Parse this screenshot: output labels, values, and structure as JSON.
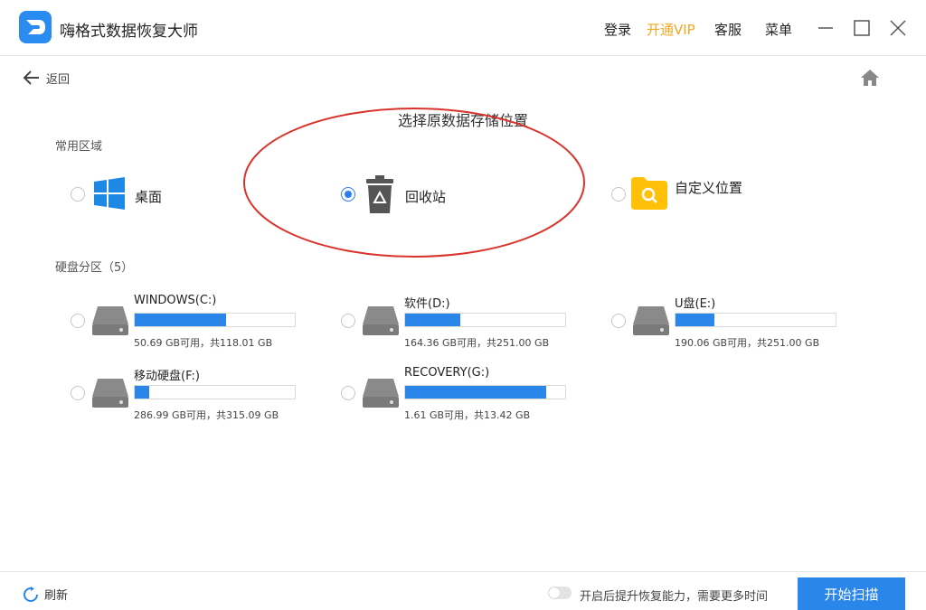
{
  "app": {
    "title": "嗨格式数据恢复大师"
  },
  "topbar": {
    "login": "登录",
    "vip": "开通VIP",
    "service": "客服",
    "menu": "菜单"
  },
  "nav": {
    "back": "返回"
  },
  "main": {
    "title": "选择原数据存储位置"
  },
  "common": {
    "label": "常用区域",
    "items": [
      {
        "label": "桌面",
        "selected": false,
        "icon": "windows-icon"
      },
      {
        "label": "回收站",
        "selected": true,
        "icon": "recycle-bin-icon"
      },
      {
        "label": "自定义位置",
        "selected": false,
        "icon": "folder-search-icon"
      }
    ]
  },
  "partitions": {
    "label": "硬盘分区（5）",
    "drives": [
      {
        "name": "WINDOWS(C:)",
        "info": "50.69 GB可用，共118.01 GB",
        "used_fraction": 0.57
      },
      {
        "name": "软件(D:)",
        "info": "164.36 GB可用，共251.00 GB",
        "used_fraction": 0.345
      },
      {
        "name": "U盘(E:)",
        "info": "190.06 GB可用，共251.00 GB",
        "used_fraction": 0.243
      },
      {
        "name": "移动硬盘(F:)",
        "info": "286.99 GB可用，共315.09 GB",
        "used_fraction": 0.089
      },
      {
        "name": "RECOVERY(G:)",
        "info": "1.61 GB可用，共13.42 GB",
        "used_fraction": 0.88
      }
    ]
  },
  "footer": {
    "refresh": "刷新",
    "toggle_text": "开启后提升恢复能力，需要更多时间",
    "toggle_on": false,
    "start": "开始扫描"
  },
  "colors": {
    "accent": "#2a86e8",
    "vip": "#f5a623",
    "annotation": "#d9342b"
  }
}
